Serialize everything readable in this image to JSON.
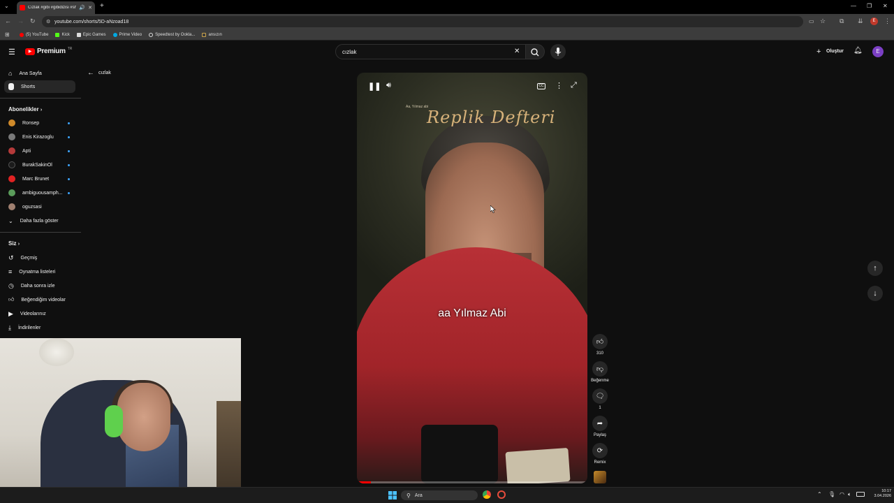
{
  "browser": {
    "tab_title": "Cızlak #gibi #gibidizisi #sh",
    "url": "youtube.com/shorts/5D-aNzoad18",
    "bookmarks": [
      "(5) YouTube",
      "Kick",
      "Epic Games",
      "Prime Video",
      "Speedtest by Ookla...",
      "ansızın"
    ],
    "bookmark_colors": [
      "#ff0000",
      "#53fc18",
      "#ffffff",
      "#00a8e1",
      "#dddddd",
      "#c9a24a"
    ]
  },
  "header": {
    "logo_text": "Premium",
    "logo_sup": "TR",
    "search_value": "cızlak",
    "create_label": "Oluştur",
    "user_initial": "E"
  },
  "sidebar": {
    "home": "Ana Sayfa",
    "shorts": "Shorts",
    "subscriptions_title": "Abonelikler",
    "subscriptions": [
      {
        "name": "Ronsep",
        "color": "#d08a2a"
      },
      {
        "name": "Enis Kirazoglu",
        "color": "#7a7a7a"
      },
      {
        "name": "Apti",
        "color": "#b53a3a"
      },
      {
        "name": "BurakSakinOl",
        "color": "#1b1b1b"
      },
      {
        "name": "Marc Brunet",
        "color": "#e02222"
      },
      {
        "name": "ambiguousamph...",
        "color": "#5a9c5a"
      },
      {
        "name": "oguzsasi",
        "color": "#a08070"
      }
    ],
    "show_more": "Daha fazla göster",
    "you_title": "Siz",
    "you_items": [
      "Geçmiş",
      "Oynatma listeleri",
      "Daha sonra izle",
      "Beğendiğim videolar",
      "Videolarınız",
      "İndirilenler"
    ]
  },
  "back": {
    "label": "cızlak"
  },
  "video": {
    "title_overlay": "Replik Defteri",
    "title_small": "Aa, Yılmaz abi",
    "caption": "aa Yılmaz Abi",
    "progress": 0.06
  },
  "actions": {
    "like_count": "310",
    "dislike_label": "Beğenme",
    "comment_count": "1",
    "share_label": "Paylaş",
    "remix_label": "Remix"
  },
  "taskbar": {
    "search_placeholder": "Ara",
    "time": "10:17",
    "date": "3.04.2026"
  }
}
